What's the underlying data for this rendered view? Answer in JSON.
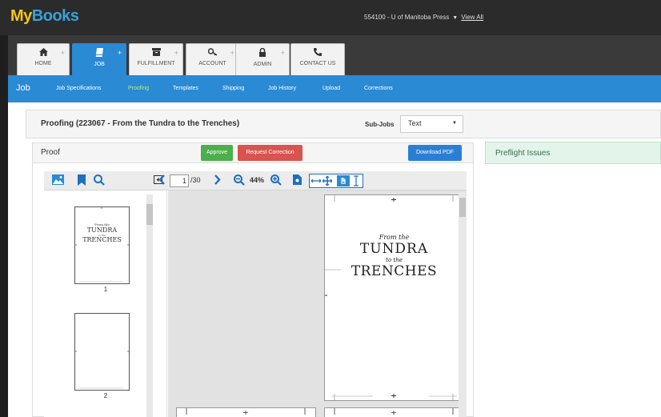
{
  "app": {
    "logo_part1": "My",
    "logo_part2": "Books"
  },
  "account": {
    "label": "554100 - U of Manitoba Press",
    "view_all": "View All"
  },
  "modules": [
    {
      "label": "HOME",
      "icon": "home-icon"
    },
    {
      "label": "JOB",
      "icon": "book-icon",
      "active": true
    },
    {
      "label": "FULFILLMENT",
      "icon": "box-icon"
    },
    {
      "label": "ACCOUNT",
      "icon": "key-icon"
    },
    {
      "label": "ADMIN",
      "icon": "lock-icon"
    },
    {
      "label": "CONTACT US",
      "icon": "phone-icon"
    }
  ],
  "subnav": {
    "title": "Job",
    "items": [
      "Job Specifications",
      "Proofing",
      "Templates",
      "Shipping",
      "Job History",
      "Upload",
      "Corrections"
    ],
    "active": "Proofing"
  },
  "job": {
    "title": "Proofing (223067 - From the Tundra to the Trenches)",
    "subjobs_label": "Sub-Jobs",
    "subjobs_value": "Text"
  },
  "proof": {
    "label": "Proof",
    "approve": "Approve",
    "request_correction": "Request Correction",
    "download": "Download PDF"
  },
  "preflight": {
    "label": "Preflight Issues"
  },
  "viewer": {
    "current_page": "1",
    "total_pages": "/30",
    "zoom": "44%"
  },
  "thumbnails": [
    {
      "number": "1",
      "line1": "From the",
      "line2": "TUNDRA",
      "line3": "to the",
      "line4": "TRENCHES"
    },
    {
      "number": "2",
      "line1": "",
      "line2": "",
      "line3": "",
      "line4": ""
    }
  ],
  "page_content": {
    "line1": "From the",
    "line2": "TUNDRA",
    "line3": "to the",
    "line4": "TRENCHES"
  },
  "colors": {
    "brand_blue": "#2a8ad4",
    "approve": "#4cae4c",
    "reject": "#d9534f",
    "preflight_bg": "#e3f5ea"
  }
}
